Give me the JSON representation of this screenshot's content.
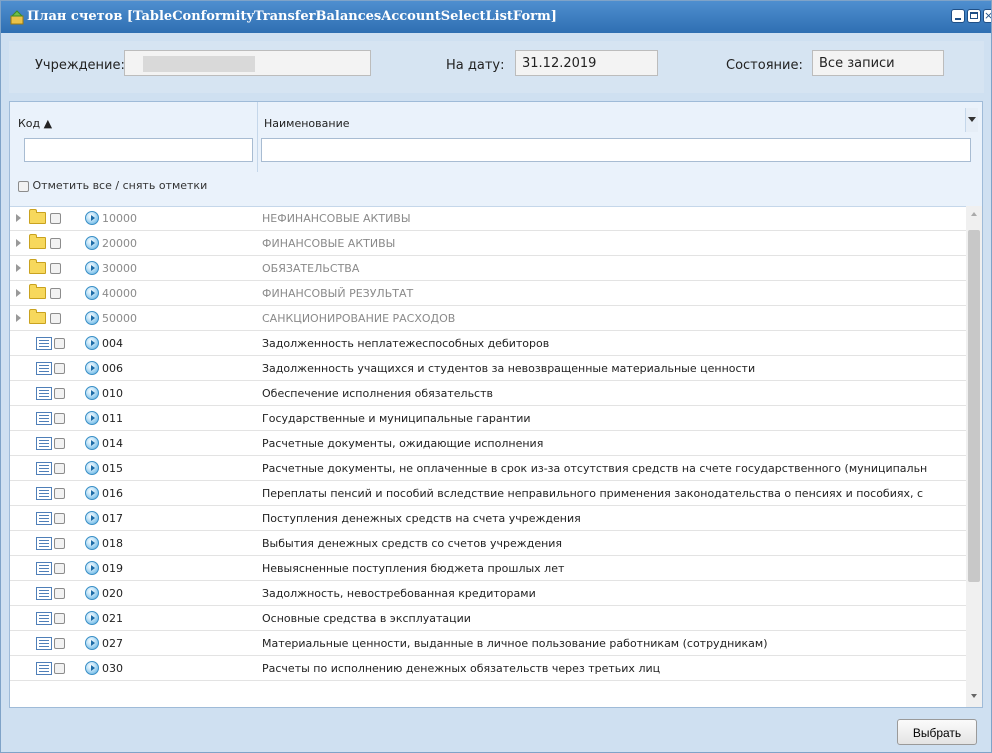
{
  "window": {
    "title": "План счетов [TableConformityTransferBalancesAccountSelectListForm]"
  },
  "filters": {
    "institution_label": "Учреждение:",
    "institution_value": "",
    "date_label": "На дату:",
    "date_value": "31.12.2019",
    "state_label": "Состояние:",
    "state_value": "Все записи"
  },
  "grid": {
    "col_code": "Код ▲",
    "col_name": "Наименование",
    "check_all": "Отметить все / снять отметки",
    "rows": [
      {
        "code": "10000",
        "name": "НЕФИНАНСОВЫЕ АКТИВЫ",
        "group": true
      },
      {
        "code": "20000",
        "name": "ФИНАНСОВЫЕ АКТИВЫ",
        "group": true
      },
      {
        "code": "30000",
        "name": "ОБЯЗАТЕЛЬСТВА",
        "group": true
      },
      {
        "code": "40000",
        "name": "ФИНАНСОВЫЙ РЕЗУЛЬТАТ",
        "group": true
      },
      {
        "code": "50000",
        "name": "САНКЦИОНИРОВАНИЕ РАСХОДОВ",
        "group": true
      },
      {
        "code": "004",
        "name": "Задолженность неплатежеспособных дебиторов",
        "group": false
      },
      {
        "code": "006",
        "name": "Задолженность учащихся и студентов за невозвращенные материальные ценности",
        "group": false
      },
      {
        "code": "010",
        "name": "Обеспечение исполнения обязательств",
        "group": false
      },
      {
        "code": "011",
        "name": "Государственные и муниципальные гарантии",
        "group": false
      },
      {
        "code": "014",
        "name": "Расчетные документы, ожидающие исполнения",
        "group": false
      },
      {
        "code": "015",
        "name": "Расчетные документы, не оплаченные в срок из-за отсутствия средств на счете государственного (муниципальн",
        "group": false
      },
      {
        "code": "016",
        "name": "Переплаты пенсий и пособий вследствие неправильного применения законодательства о пенсиях и пособиях, с",
        "group": false
      },
      {
        "code": "017",
        "name": "Поступления денежных средств на счета учреждения",
        "group": false
      },
      {
        "code": "018",
        "name": "Выбытия денежных средств со счетов учреждения",
        "group": false
      },
      {
        "code": "019",
        "name": "Невыясненные поступления бюджета прошлых лет",
        "group": false
      },
      {
        "code": "020",
        "name": "Задолжность, невостребованная кредиторами",
        "group": false
      },
      {
        "code": "021",
        "name": "Основные средства в эксплуатации",
        "group": false
      },
      {
        "code": "027",
        "name": "Материальные ценности, выданные в личное пользование работникам (сотрудникам)",
        "group": false
      },
      {
        "code": "030",
        "name": "Расчеты по исполнению денежных обязательств через третьих лиц",
        "group": false
      }
    ]
  },
  "footer": {
    "select_label": "Выбрать"
  },
  "colors": {
    "titlebar": "#2f6fb2",
    "window_bg": "#cfe0f1",
    "header_bg": "#eaf2fb"
  }
}
